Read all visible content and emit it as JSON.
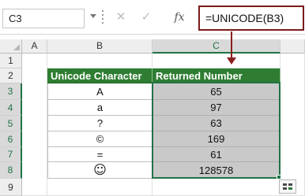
{
  "formula_bar": {
    "name_box": "C3",
    "cancel_icon": "✕",
    "enter_icon": "✓",
    "fx_label": "fx",
    "formula": "=UNICODE(B3)"
  },
  "columns": [
    "A",
    "B",
    "C"
  ],
  "rows": [
    "1",
    "2",
    "3",
    "4",
    "5",
    "6",
    "7",
    "8",
    "9"
  ],
  "table": {
    "headers": [
      "Unicode Character",
      "Returned Number"
    ],
    "rows": [
      {
        "char": "A",
        "num": "65"
      },
      {
        "char": "a",
        "num": "97"
      },
      {
        "char": "?",
        "num": "63"
      },
      {
        "char": "©",
        "num": "169"
      },
      {
        "char": "=",
        "num": "61"
      },
      {
        "char": "☺",
        "num": "128578"
      }
    ]
  },
  "colors": {
    "header_green": "#2e7d32",
    "selection_green": "#217346",
    "arrow_red": "#8a1f1f",
    "cell_gray": "#c9c9c9"
  },
  "icons": [
    "dropdown-caret-icon",
    "cancel-icon",
    "enter-icon",
    "fx-icon",
    "arrow-down-icon",
    "smiley-icon",
    "quick-analysis-icon"
  ]
}
